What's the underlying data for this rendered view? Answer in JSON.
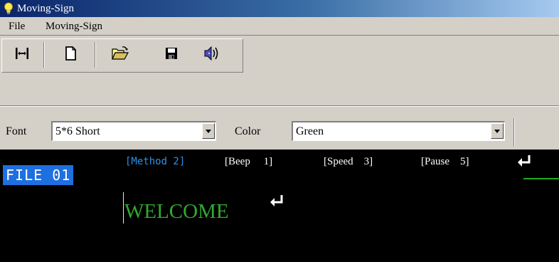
{
  "window": {
    "title": "Moving-Sign",
    "icon": "lightbulb-icon"
  },
  "menu": {
    "items": [
      {
        "label": "File"
      },
      {
        "label": "Moving-Sign"
      }
    ]
  },
  "toolbar": {
    "buttons": [
      {
        "icon": "transfer-icon"
      },
      {
        "icon": "new-document-icon"
      },
      {
        "icon": "open-folder-icon"
      },
      {
        "icon": "save-disk-icon"
      },
      {
        "icon": "speaker-sound-icon"
      }
    ]
  },
  "options": {
    "font_label": "Font",
    "font_value": "5*6 Short",
    "color_label": "Color",
    "color_value": "Green"
  },
  "editor": {
    "file_label": "FILE 01",
    "params": {
      "method": "[Method 2]",
      "beep": "[Beep     1]",
      "speed": "[Speed    3]",
      "pause": "[Pause    5]"
    },
    "message": "WELCOME",
    "colors": {
      "background": "#000000",
      "file_highlight": "#1e6fe0",
      "method_text": "#2f8fe8",
      "message_text": "#2faa2f"
    }
  }
}
